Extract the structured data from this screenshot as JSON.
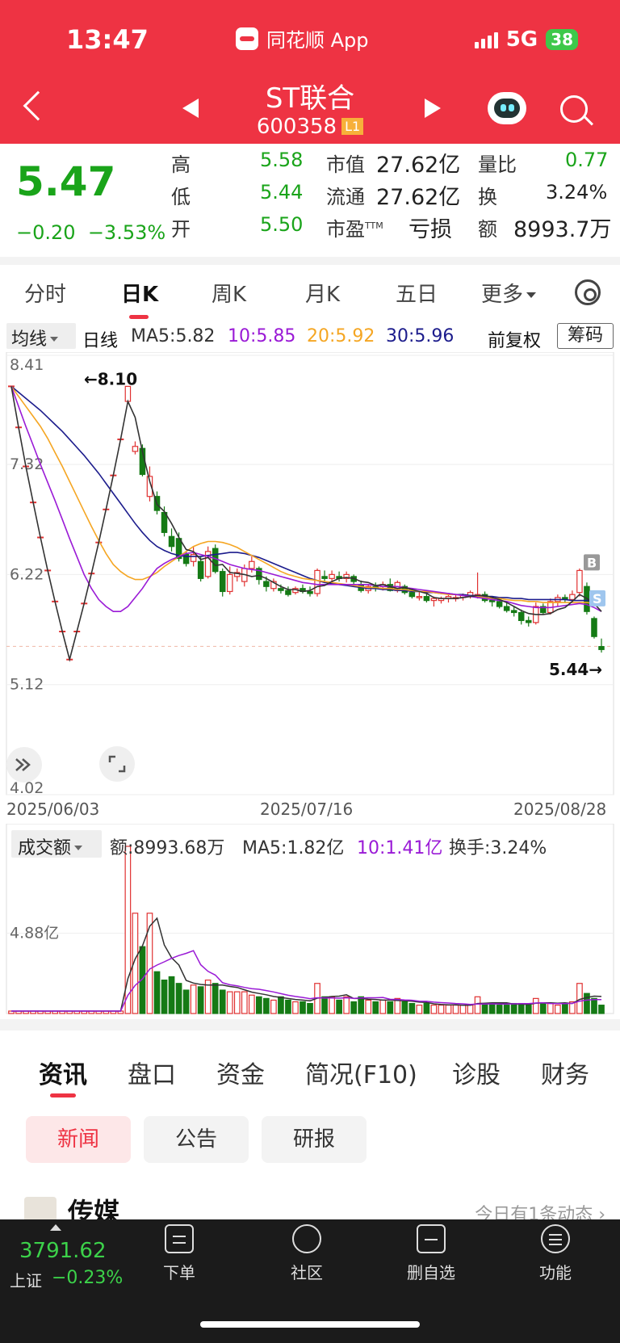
{
  "status_bar": {
    "time": "13:47",
    "app": "同花顺 App",
    "network": "5G",
    "battery": "38"
  },
  "header": {
    "title": "ST联合",
    "code": "600358",
    "level": "L1"
  },
  "quote": {
    "price": "5.47",
    "change": "−0.20",
    "change_pct": "−3.53%",
    "high_label": "高",
    "high": "5.58",
    "low_label": "低",
    "low": "5.44",
    "open_label": "开",
    "open": "5.50",
    "mcap_label": "市值",
    "mcap": "27.62亿",
    "float_label": "流通",
    "float": "27.62亿",
    "pe_label": "市盈",
    "pe_sup": "TTM",
    "pe": "亏损",
    "vr_label": "量比",
    "vr": "0.77",
    "turnover_label": "换",
    "turnover": "3.24%",
    "amount_label": "额",
    "amount": "8993.7万"
  },
  "tabs": [
    "分时",
    "日K",
    "周K",
    "月K",
    "五日",
    "更多"
  ],
  "ma_row": {
    "selector": "均线",
    "type": "日线",
    "ma5": "MA5:5.82",
    "ma10": "10:5.85",
    "ma20": "20:5.92",
    "ma30": "30:5.96",
    "adjust": "前复权",
    "chip": "筹码"
  },
  "colors": {
    "up": "#e03131",
    "down": "#157a15",
    "ma5": "#333333",
    "ma10": "#9a1ad6",
    "ma20": "#f5a623",
    "ma30": "#1c1c8c",
    "header": "#ee3343"
  },
  "kline_labels": {
    "y_ticks": [
      "8.41",
      "7.32",
      "6.22",
      "5.12",
      "4.02"
    ],
    "max_label": "←8.10",
    "min_label": "5.44→",
    "b_mark": "B",
    "s_mark": "S"
  },
  "dates": [
    "2025/06/03",
    "2025/07/16",
    "2025/08/28"
  ],
  "volume": {
    "selector": "成交额",
    "amount": "额:8993.68万",
    "ma5": "MA5:1.82亿",
    "ma10": "10:1.41亿",
    "turnover": "换手:3.24%",
    "y_tick": "4.88亿"
  },
  "info_tabs": [
    "资讯",
    "盘口",
    "资金",
    "简况(F10)",
    "诊股",
    "财务"
  ],
  "pills": [
    "新闻",
    "公告",
    "研报"
  ],
  "news": {
    "title": "传媒",
    "right": "今日有1条动态 ›"
  },
  "bottom": {
    "index": "3791.62",
    "index_name": "上证",
    "index_pct": "−0.23%",
    "items": [
      "下单",
      "社区",
      "删自选",
      "功能"
    ]
  },
  "chart_data": {
    "type": "candlestick",
    "ylim": [
      4.02,
      8.41
    ],
    "y_ticks": [
      8.41,
      7.32,
      6.22,
      5.12,
      4.02
    ],
    "x_labels": [
      "2025/06/03",
      "2025/07/16",
      "2025/08/28"
    ],
    "candles": [
      [
        8.1,
        8.1,
        8.1,
        8.1,
        0.0
      ],
      [
        7.69,
        7.69,
        7.69,
        7.69,
        0.0
      ],
      [
        7.3,
        7.3,
        7.3,
        7.3,
        0.0
      ],
      [
        6.94,
        6.94,
        6.94,
        6.94,
        0.0
      ],
      [
        6.59,
        6.59,
        6.59,
        6.59,
        0.0
      ],
      [
        6.26,
        6.26,
        6.26,
        6.26,
        0.0
      ],
      [
        5.95,
        5.95,
        5.95,
        5.95,
        0.0
      ],
      [
        5.65,
        5.65,
        5.65,
        5.65,
        0.0
      ],
      [
        5.37,
        5.37,
        5.37,
        5.37,
        0.0
      ],
      [
        5.65,
        5.65,
        5.65,
        5.65,
        0.0
      ],
      [
        5.93,
        5.93,
        5.93,
        5.93,
        0.0
      ],
      [
        6.23,
        6.23,
        6.23,
        6.23,
        0.0
      ],
      [
        6.54,
        6.54,
        6.54,
        6.54,
        0.0
      ],
      [
        6.87,
        6.87,
        6.87,
        6.87,
        0.0
      ],
      [
        7.21,
        7.21,
        7.21,
        7.21,
        0.0
      ],
      [
        7.57,
        7.57,
        7.57,
        7.57,
        0.0
      ],
      [
        7.95,
        8.1,
        7.95,
        8.1,
        1.0
      ],
      [
        7.45,
        7.55,
        7.42,
        7.5,
        0.6
      ],
      [
        7.48,
        7.52,
        7.2,
        7.22,
        0.4
      ],
      [
        7.0,
        7.3,
        6.95,
        7.2,
        0.6
      ],
      [
        7.0,
        7.05,
        6.82,
        6.86,
        0.25
      ],
      [
        6.84,
        6.9,
        6.6,
        6.64,
        0.2
      ],
      [
        6.6,
        6.68,
        6.45,
        6.5,
        0.22
      ],
      [
        6.58,
        6.64,
        6.35,
        6.38,
        0.18
      ],
      [
        6.42,
        6.45,
        6.3,
        6.33,
        0.14
      ],
      [
        6.35,
        6.5,
        6.3,
        6.42,
        0.17
      ],
      [
        6.35,
        6.4,
        6.15,
        6.18,
        0.16
      ],
      [
        6.2,
        6.5,
        6.18,
        6.45,
        0.2
      ],
      [
        6.48,
        6.52,
        6.23,
        6.25,
        0.18
      ],
      [
        6.25,
        6.28,
        6.0,
        6.05,
        0.14
      ],
      [
        6.05,
        6.3,
        6.02,
        6.22,
        0.13
      ],
      [
        6.2,
        6.28,
        6.15,
        6.24,
        0.13
      ],
      [
        6.15,
        6.32,
        6.1,
        6.28,
        0.13
      ],
      [
        6.28,
        6.4,
        6.24,
        6.35,
        0.11
      ],
      [
        6.28,
        6.3,
        6.12,
        6.17,
        0.1
      ],
      [
        6.15,
        6.2,
        6.05,
        6.1,
        0.09
      ],
      [
        6.08,
        6.18,
        6.05,
        6.15,
        0.08
      ],
      [
        6.08,
        6.12,
        6.03,
        6.06,
        0.1
      ],
      [
        6.06,
        6.1,
        6.0,
        6.02,
        0.08
      ],
      [
        6.04,
        6.1,
        6.02,
        6.08,
        0.07
      ],
      [
        6.08,
        6.12,
        6.03,
        6.05,
        0.07
      ],
      [
        6.05,
        6.1,
        6.0,
        6.03,
        0.06
      ],
      [
        6.03,
        6.28,
        6.0,
        6.26,
        0.18
      ],
      [
        6.2,
        6.26,
        6.15,
        6.18,
        0.1
      ],
      [
        6.18,
        6.26,
        6.15,
        6.22,
        0.1
      ],
      [
        6.2,
        6.25,
        6.15,
        6.18,
        0.08
      ],
      [
        6.18,
        6.25,
        6.14,
        6.22,
        0.1
      ],
      [
        6.2,
        6.22,
        6.12,
        6.15,
        0.07
      ],
      [
        6.12,
        6.16,
        6.04,
        6.06,
        0.1
      ],
      [
        6.06,
        6.12,
        6.03,
        6.1,
        0.08
      ],
      [
        6.1,
        6.14,
        6.05,
        6.08,
        0.07
      ],
      [
        6.1,
        6.15,
        6.06,
        6.12,
        0.08
      ],
      [
        6.12,
        6.18,
        6.05,
        6.06,
        0.07
      ],
      [
        6.06,
        6.16,
        6.04,
        6.14,
        0.09
      ],
      [
        6.1,
        6.12,
        6.02,
        6.04,
        0.07
      ],
      [
        6.04,
        6.08,
        5.98,
        6.0,
        0.06
      ],
      [
        6.0,
        6.05,
        5.96,
        6.0,
        0.05
      ],
      [
        6.0,
        6.06,
        5.94,
        5.96,
        0.06
      ],
      [
        5.96,
        6.0,
        5.9,
        5.98,
        0.05
      ],
      [
        5.96,
        6.0,
        5.93,
        5.98,
        0.05
      ],
      [
        5.98,
        6.02,
        5.94,
        6.0,
        0.05
      ],
      [
        5.98,
        6.02,
        5.95,
        5.99,
        0.05
      ],
      [
        5.99,
        6.03,
        5.96,
        6.01,
        0.05
      ],
      [
        6.01,
        6.06,
        5.98,
        6.04,
        0.05
      ],
      [
        6.0,
        6.24,
        5.98,
        6.02,
        0.1
      ],
      [
        6.02,
        6.05,
        5.94,
        5.96,
        0.06
      ],
      [
        5.96,
        6.0,
        5.9,
        5.95,
        0.06
      ],
      [
        5.95,
        5.98,
        5.88,
        5.9,
        0.05
      ],
      [
        5.9,
        5.94,
        5.84,
        5.86,
        0.05
      ],
      [
        5.86,
        5.9,
        5.8,
        5.84,
        0.06
      ],
      [
        5.84,
        5.87,
        5.72,
        5.76,
        0.06
      ],
      [
        5.76,
        5.8,
        5.7,
        5.74,
        0.05
      ],
      [
        5.74,
        5.94,
        5.72,
        5.9,
        0.09
      ],
      [
        5.9,
        5.93,
        5.82,
        5.84,
        0.06
      ],
      [
        5.84,
        5.98,
        5.82,
        5.95,
        0.06
      ],
      [
        5.95,
        6.02,
        5.9,
        5.99,
        0.05
      ],
      [
        5.99,
        6.02,
        5.94,
        5.97,
        0.06
      ],
      [
        5.97,
        6.06,
        5.95,
        6.02,
        0.07
      ],
      [
        6.04,
        6.28,
        6.0,
        6.26,
        0.18
      ],
      [
        6.1,
        6.14,
        5.82,
        5.85,
        0.12
      ],
      [
        5.78,
        5.8,
        5.58,
        5.6,
        0.09
      ],
      [
        5.5,
        5.58,
        5.44,
        5.47,
        0.05
      ]
    ],
    "ma5": [
      8.1,
      7.69,
      7.3,
      6.94,
      6.59,
      6.26,
      5.95,
      5.65,
      5.37,
      5.65,
      5.93,
      6.23,
      6.54,
      6.87,
      7.21,
      7.57,
      7.95,
      7.79,
      7.45,
      7.15,
      6.92,
      6.85,
      6.73,
      6.59,
      6.47,
      6.45,
      6.37,
      6.39,
      6.31,
      6.32,
      6.24,
      6.23,
      6.22,
      6.2,
      6.21,
      6.18,
      6.14,
      6.1,
      6.07,
      6.07,
      6.05,
      6.06,
      6.1,
      6.11,
      6.15,
      6.18,
      6.19,
      6.18,
      6.15,
      6.14,
      6.11,
      6.12,
      6.1,
      6.08,
      6.09,
      6.07,
      6.05,
      6.03,
      5.99,
      5.98,
      5.98,
      5.98,
      5.99,
      6.0,
      6.01,
      6.01,
      5.99,
      5.97,
      5.94,
      5.9,
      5.86,
      5.83,
      5.82,
      5.82,
      5.83,
      5.87,
      5.89,
      5.95,
      6.02,
      5.98,
      5.93,
      5.85
    ],
    "ma10": [
      8.1,
      7.9,
      7.7,
      7.51,
      7.32,
      7.14,
      6.96,
      6.77,
      6.58,
      6.4,
      6.22,
      6.08,
      5.97,
      5.9,
      5.85,
      5.85,
      5.9,
      5.99,
      6.08,
      6.19,
      6.28,
      6.33,
      6.37,
      6.4,
      6.43,
      6.44,
      6.42,
      6.4,
      6.38,
      6.35,
      6.32,
      6.3,
      6.28,
      6.27,
      6.26,
      6.24,
      6.22,
      6.2,
      6.18,
      6.16,
      6.14,
      6.13,
      6.12,
      6.12,
      6.12,
      6.12,
      6.12,
      6.12,
      6.12,
      6.12,
      6.11,
      6.1,
      6.1,
      6.1,
      6.09,
      6.08,
      6.07,
      6.06,
      6.05,
      6.04,
      6.03,
      6.02,
      6.01,
      6.0,
      5.99,
      5.98,
      5.97,
      5.96,
      5.95,
      5.93,
      5.91,
      5.9,
      5.89,
      5.89,
      5.89,
      5.9,
      5.91,
      5.92,
      5.93,
      5.92,
      5.89,
      5.85
    ],
    "ma20": [
      8.1,
      8.0,
      7.9,
      7.8,
      7.7,
      7.58,
      7.44,
      7.3,
      7.15,
      7.0,
      6.85,
      6.7,
      6.56,
      6.43,
      6.32,
      6.25,
      6.2,
      6.17,
      6.17,
      6.2,
      6.24,
      6.3,
      6.35,
      6.4,
      6.45,
      6.5,
      6.53,
      6.55,
      6.55,
      6.54,
      6.52,
      6.49,
      6.45,
      6.41,
      6.37,
      6.33,
      6.29,
      6.25,
      6.22,
      6.2,
      6.18,
      6.17,
      6.16,
      6.15,
      6.14,
      6.13,
      6.12,
      6.11,
      6.1,
      6.09,
      6.09,
      6.08,
      6.08,
      6.07,
      6.07,
      6.06,
      6.05,
      6.05,
      6.04,
      6.03,
      6.02,
      6.02,
      6.01,
      6.0,
      6.0,
      5.99,
      5.98,
      5.98,
      5.97,
      5.96,
      5.96,
      5.95,
      5.95,
      5.94,
      5.94,
      5.94,
      5.94,
      5.94,
      5.94,
      5.94,
      5.93,
      5.92
    ],
    "ma30": [
      8.1,
      8.04,
      7.98,
      7.92,
      7.86,
      7.79,
      7.72,
      7.65,
      7.57,
      7.49,
      7.41,
      7.32,
      7.23,
      7.13,
      7.03,
      6.93,
      6.83,
      6.73,
      6.64,
      6.56,
      6.5,
      6.46,
      6.43,
      6.41,
      6.4,
      6.4,
      6.4,
      6.41,
      6.42,
      6.43,
      6.44,
      6.44,
      6.43,
      6.41,
      6.39,
      6.36,
      6.33,
      6.3,
      6.27,
      6.24,
      6.21,
      6.18,
      6.16,
      6.14,
      6.13,
      6.12,
      6.11,
      6.1,
      6.09,
      6.08,
      6.08,
      6.07,
      6.07,
      6.06,
      6.06,
      6.05,
      6.05,
      6.04,
      6.04,
      6.03,
      6.03,
      6.02,
      6.02,
      6.01,
      6.01,
      6.0,
      6.0,
      5.99,
      5.99,
      5.98,
      5.98,
      5.97,
      5.97,
      5.97,
      5.97,
      5.97,
      5.97,
      5.96,
      5.96,
      5.96,
      5.96,
      5.96
    ]
  }
}
